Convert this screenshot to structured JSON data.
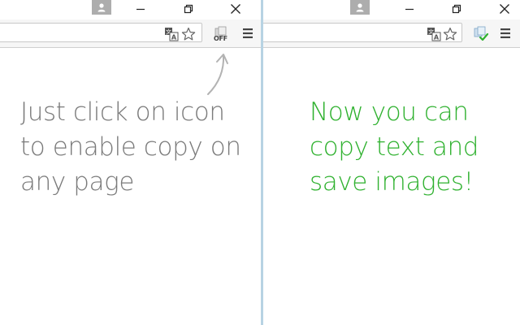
{
  "left_panel": {
    "message_lines": [
      "Just click on icon",
      "to enable copy on",
      "any page"
    ],
    "extension_state_label": "OFF",
    "extension_icon": "copy-extension-off-icon",
    "text_color": "#7a7a7a"
  },
  "right_panel": {
    "message_lines": [
      "Now you can",
      "copy text and",
      "save images!"
    ],
    "extension_icon": "copy-extension-on-icon",
    "text_color": "#2fb12f"
  },
  "window_controls": [
    "minimize-icon",
    "maximize-icon",
    "close-icon"
  ],
  "toolbar_icons": [
    "translate-icon",
    "star-icon",
    "menu-icon"
  ],
  "colors": {
    "divider": "#b7d3e3",
    "toolbar": "#f6f6f6",
    "success_green": "#2fb12f",
    "hint_gray": "#7a7a7a"
  }
}
